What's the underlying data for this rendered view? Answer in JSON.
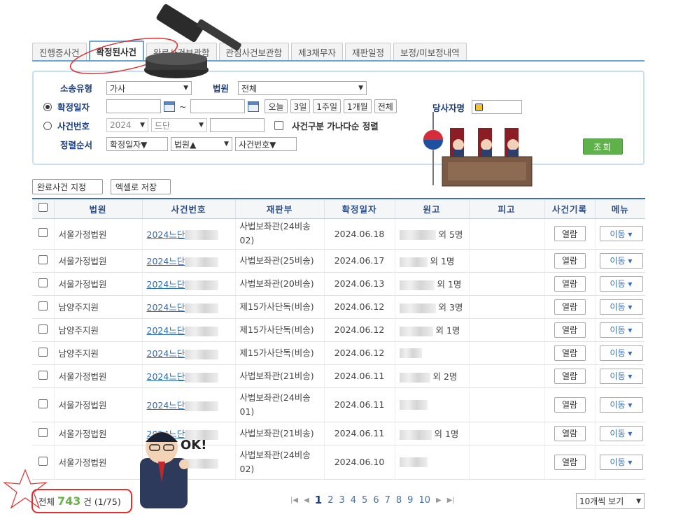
{
  "tabs": [
    {
      "label": "진행중사건",
      "active": false
    },
    {
      "label": "확정된사건",
      "active": true
    },
    {
      "label": "완료사건보관함",
      "active": false
    },
    {
      "label": "관심사건보관함",
      "active": false
    },
    {
      "label": "제3채무자",
      "active": false
    },
    {
      "label": "재판일정",
      "active": false
    },
    {
      "label": "보정/미보정내역",
      "active": false
    }
  ],
  "search": {
    "case_type_label": "소송유형",
    "case_type_value": "가사",
    "court_label": "법원",
    "court_value": "전체",
    "confirm_date_label": "확정일자",
    "date_sep": "~",
    "quick_today": "오늘",
    "quick_3d": "3일",
    "quick_1w": "1주일",
    "quick_1m": "1개월",
    "quick_all": "전체",
    "party_label": "당사자명",
    "case_no_label": "사건번호",
    "year_value": "2024",
    "case_kind_value": "드단",
    "sort_check_label": "사건구분 가나다순 정렬",
    "order_label": "정렬순서",
    "order1": "확정일자▼",
    "order2": "법원▲",
    "order3": "사건번호▼",
    "search_btn": "조회"
  },
  "actions": {
    "mark_complete": "완료사건 지정",
    "save_excel": "엑셀로 저장"
  },
  "table": {
    "headers": [
      "법원",
      "사건번호",
      "재판부",
      "확정일자",
      "원고",
      "피고",
      "사건기록",
      "메뉴"
    ],
    "view_label": "열람",
    "move_label": "이동 ▾",
    "rows": [
      {
        "court": "서울가정법원",
        "case_no": "2024느단",
        "dept": "사법보좌관(24비송 02)",
        "date": "2024.06.18",
        "plaintiff_suffix": "외 5명"
      },
      {
        "court": "서울가정법원",
        "case_no": "2024느단",
        "dept": "사법보좌관(25비송)",
        "date": "2024.06.17",
        "plaintiff_suffix": "외 1명"
      },
      {
        "court": "서울가정법원",
        "case_no": "2024느단",
        "dept": "사법보좌관(20비송)",
        "date": "2024.06.13",
        "plaintiff_suffix": "외 1명"
      },
      {
        "court": "남양주지원",
        "case_no": "2024느단",
        "dept": "제15가사단독(비송)",
        "date": "2024.06.12",
        "plaintiff_suffix": "외 3명"
      },
      {
        "court": "남양주지원",
        "case_no": "2024느단",
        "dept": "제15가사단독(비송)",
        "date": "2024.06.12",
        "plaintiff_suffix": "외 1명"
      },
      {
        "court": "남양주지원",
        "case_no": "2024느단",
        "dept": "제15가사단독(비송)",
        "date": "2024.06.12",
        "plaintiff_suffix": ""
      },
      {
        "court": "서울가정법원",
        "case_no": "2024느단",
        "dept": "사법보좌관(21비송)",
        "date": "2024.06.11",
        "plaintiff_suffix": "외 2명"
      },
      {
        "court": "서울가정법원",
        "case_no": "2024느단",
        "dept": "사법보좌관(24비송 01)",
        "date": "2024.06.11",
        "plaintiff_suffix": ""
      },
      {
        "court": "서울가정법원",
        "case_no": "2024느단",
        "dept": "사법보좌관(21비송)",
        "date": "2024.06.11",
        "plaintiff_suffix": "외 1명"
      },
      {
        "court": "서울가정법원",
        "case_no": "2024느단",
        "dept": "사법보좌관(24비송 02)",
        "date": "2024.06.10",
        "plaintiff_suffix": ""
      }
    ]
  },
  "footer": {
    "total_prefix": "전체",
    "total_count": "743",
    "total_suffix": "건 (1/75)",
    "pages": [
      "1",
      "2",
      "3",
      "4",
      "5",
      "6",
      "7",
      "8",
      "9",
      "10"
    ],
    "current_page": "1",
    "per_page": "10개씩 보기"
  },
  "stickers": {
    "ok_text": "OK!"
  },
  "colors": {
    "tab_active_border": "#6aa7d8",
    "header_rule": "#3f6fb2",
    "search_button": "#5fb14a",
    "link": "#2a6bbf",
    "count_green": "#6ab04c",
    "annotation_red": "#e03030"
  }
}
